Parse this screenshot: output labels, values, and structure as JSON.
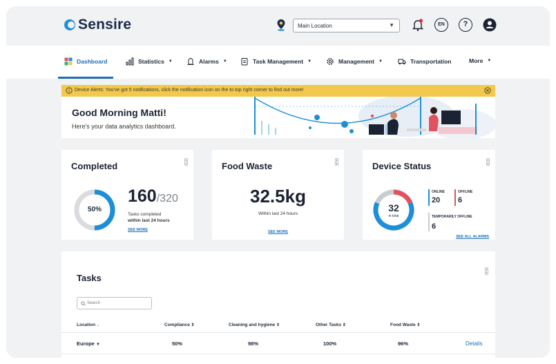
{
  "brand": {
    "name": "Sensire"
  },
  "header": {
    "location_value": "Main Location",
    "language": "EN",
    "icons": [
      "location-pin-icon",
      "notification-bell-icon",
      "language-icon",
      "help-icon",
      "user-icon"
    ]
  },
  "nav": {
    "items": [
      {
        "label": "Dashboard",
        "icon": "dashboard-icon",
        "dropdown": false,
        "active": true
      },
      {
        "label": "Statistics",
        "icon": "statistics-icon",
        "dropdown": true
      },
      {
        "label": "Alarms",
        "icon": "alarms-icon",
        "dropdown": true
      },
      {
        "label": "Task Management",
        "icon": "task-icon",
        "dropdown": true
      },
      {
        "label": "Management",
        "icon": "gear-icon",
        "dropdown": true
      },
      {
        "label": "Transportation",
        "icon": "truck-icon",
        "dropdown": false
      },
      {
        "label": "More",
        "icon": "",
        "dropdown": true
      }
    ]
  },
  "alert": {
    "text": "Device Alerts: You've got 5 notifications, click the notification icon on the to top right corner to find out more!"
  },
  "hero": {
    "greeting": "Good Morning Matti!",
    "subtitle": "Here's your data analytics dashboard."
  },
  "completed": {
    "title": "Completed",
    "percent_label": "50%",
    "percent": 0.5,
    "count": "160",
    "total": "/320",
    "line1": "Tasks completed",
    "line2": "within last 24 hours",
    "link": "SEE MORE"
  },
  "food_waste": {
    "title": "Food Waste",
    "value": "32.5kg",
    "caption": "Within last 24 hours",
    "link": "SEE MORE"
  },
  "device_status": {
    "title": "Device Status",
    "total": "32",
    "total_caption": "in total",
    "online_label": "ONLINE",
    "online_value": "20",
    "offline_label": "OFFLINE",
    "offline_value": "6",
    "temp_label": "TEMPORARILY OFFLINE",
    "temp_value": "6",
    "link": "SEE ALL ALARMS",
    "colors": {
      "online": "#1e8fd6",
      "offline": "#e0525e",
      "temp": "#c9ccd1"
    }
  },
  "tasks": {
    "title": "Tasks",
    "search_placeholder": "Search",
    "columns": [
      "Location",
      "Compliance",
      "Cleaning and hygiene",
      "Other Tasks",
      "Food Waste"
    ],
    "rows": [
      {
        "location": "Europe",
        "compliance": "50%",
        "cleaning": "98%",
        "other": "100%",
        "food": "96%",
        "action": "Details"
      }
    ]
  },
  "colors": {
    "accent": "#1a6fb8",
    "alert_bg": "#f2c94c",
    "brand": "#1e8fd6"
  }
}
